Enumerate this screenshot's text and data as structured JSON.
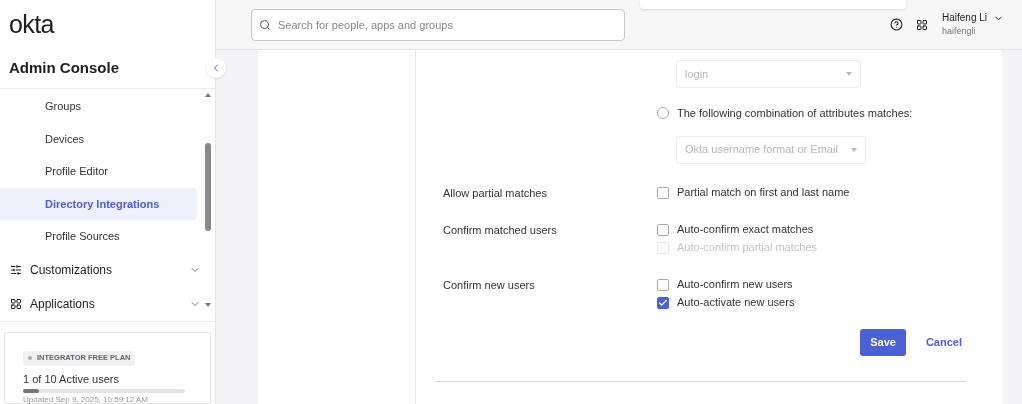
{
  "logo": "okta",
  "console_title": "Admin Console",
  "nav": [
    {
      "label": "Groups",
      "kind": "sub",
      "selected": false
    },
    {
      "label": "Devices",
      "kind": "sub",
      "selected": false
    },
    {
      "label": "Profile Editor",
      "kind": "sub",
      "selected": false
    },
    {
      "label": "Directory Integrations",
      "kind": "sub",
      "selected": true
    },
    {
      "label": "Profile Sources",
      "kind": "sub",
      "selected": false
    },
    {
      "label": "Customizations",
      "kind": "section",
      "selected": false,
      "expanded": false
    },
    {
      "label": "Applications",
      "kind": "section",
      "selected": false,
      "expanded": false
    }
  ],
  "plan": {
    "badge": "INTEGRATOR FREE PLAN",
    "users": "1 of 10 Active users",
    "level": 0.1,
    "updated": "Updated Sep 9, 2025, 10:59:12 AM"
  },
  "search": {
    "placeholder": "Search for people, apps and groups"
  },
  "user": {
    "name": "Haifeng Li",
    "username": "haifengli"
  },
  "form": {
    "top_select": {
      "value": "login",
      "disabled": true
    },
    "radio": {
      "label": "The following combination of attributes matches:",
      "selected": false
    },
    "combo_select": {
      "value": "Okta username format or Email",
      "disabled": true
    },
    "rows": [
      {
        "label": "Allow partial matches",
        "options": [
          {
            "label": "Partial match on first and last name",
            "checked": false,
            "disabled": false
          }
        ]
      },
      {
        "label": "Confirm matched users",
        "options": [
          {
            "label": "Auto-confirm exact matches",
            "checked": false,
            "disabled": false
          },
          {
            "label": "Auto-confirm partial matches",
            "checked": false,
            "disabled": true
          }
        ]
      },
      {
        "label": "Confirm new users",
        "options": [
          {
            "label": "Auto-confirm new users",
            "checked": false,
            "disabled": false
          },
          {
            "label": "Auto-activate new users",
            "checked": true,
            "disabled": false
          }
        ]
      }
    ],
    "save": "Save",
    "cancel": "Cancel"
  }
}
